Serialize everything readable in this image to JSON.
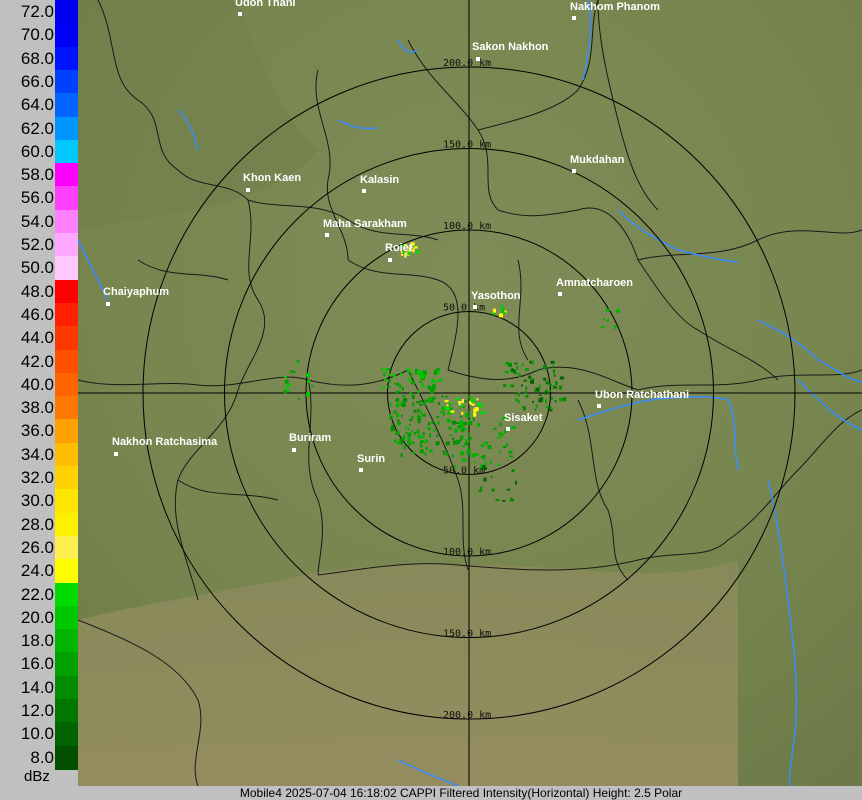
{
  "legend": {
    "unit": "dBz",
    "scale": [
      {
        "label": "72.0",
        "color": "#0000f0"
      },
      {
        "label": "70.0",
        "color": "#0000f8"
      },
      {
        "label": "68.0",
        "color": "#0014ff"
      },
      {
        "label": "66.0",
        "color": "#0040ff"
      },
      {
        "label": "64.0",
        "color": "#0064ff"
      },
      {
        "label": "62.0",
        "color": "#0096ff"
      },
      {
        "label": "60.0",
        "color": "#00c8ff"
      },
      {
        "label": "58.0",
        "color": "#ff00ff"
      },
      {
        "label": "56.0",
        "color": "#ff40ff"
      },
      {
        "label": "54.0",
        "color": "#ff80ff"
      },
      {
        "label": "52.0",
        "color": "#ffa8ff"
      },
      {
        "label": "50.0",
        "color": "#ffc8ff"
      },
      {
        "label": "48.0",
        "color": "#ff0000"
      },
      {
        "label": "46.0",
        "color": "#ff2000"
      },
      {
        "label": "44.0",
        "color": "#ff3800"
      },
      {
        "label": "42.0",
        "color": "#ff5000"
      },
      {
        "label": "40.0",
        "color": "#ff6400"
      },
      {
        "label": "38.0",
        "color": "#ff7800"
      },
      {
        "label": "36.0",
        "color": "#ffa000"
      },
      {
        "label": "34.0",
        "color": "#ffbe00"
      },
      {
        "label": "32.0",
        "color": "#ffd200"
      },
      {
        "label": "30.0",
        "color": "#ffe600"
      },
      {
        "label": "28.0",
        "color": "#fff000"
      },
      {
        "label": "26.0",
        "color": "#fff050"
      },
      {
        "label": "24.0",
        "color": "#ffff00"
      },
      {
        "label": "22.0",
        "color": "#00dc00"
      },
      {
        "label": "20.0",
        "color": "#00c800"
      },
      {
        "label": "18.0",
        "color": "#00b400"
      },
      {
        "label": "16.0",
        "color": "#00a000"
      },
      {
        "label": "14.0",
        "color": "#008c00"
      },
      {
        "label": "12.0",
        "color": "#007800"
      },
      {
        "label": "10.0",
        "color": "#006400"
      },
      {
        "label": "8.0",
        "color": "#005000"
      }
    ]
  },
  "rings": [
    {
      "label": "50.0 km",
      "km": 50
    },
    {
      "label": "100.0 km",
      "km": 100
    },
    {
      "label": "150.0 km",
      "km": 150
    },
    {
      "label": "200.0 km",
      "km": 200
    }
  ],
  "cities": [
    {
      "name": "Udon Thani"
    },
    {
      "name": "Nakhom Phanom"
    },
    {
      "name": "Sakon Nakhon"
    },
    {
      "name": "Mukdahan"
    },
    {
      "name": "Khon Kaen"
    },
    {
      "name": "Kalasin"
    },
    {
      "name": "Maha Sarakham"
    },
    {
      "name": "Roiet"
    },
    {
      "name": "Amnatcharoen"
    },
    {
      "name": "Yasothon"
    },
    {
      "name": "Chaiyaphum"
    },
    {
      "name": "Ubon Ratchathani"
    },
    {
      "name": "Sisaket"
    },
    {
      "name": "Nakhon Ratchasima"
    },
    {
      "name": "Buriram"
    },
    {
      "name": "Surin"
    }
  ],
  "footer": {
    "text": "Mobile4 2025-07-04 16:18:02 CAPPI Filtered Intensity(Horizontal)  Height: 2.5 Polar"
  },
  "colors": {
    "terrain": "#7d8a55",
    "ring": "#000000",
    "river": "#3a8cff",
    "border": "#1a1a1a"
  }
}
